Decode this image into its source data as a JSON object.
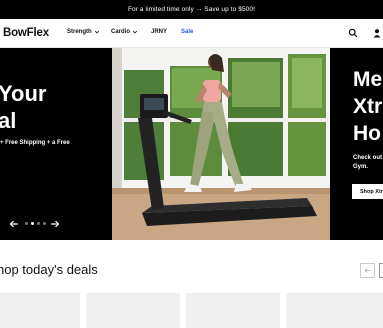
{
  "promo": {
    "text": "For a limited time only → Save up to $500!"
  },
  "nav": {
    "logo": "BowFlex",
    "items": [
      {
        "label": "Strength",
        "dropdown": true
      },
      {
        "label": "Cardio",
        "dropdown": true
      },
      {
        "label": "JRNY",
        "dropdown": false
      },
      {
        "label": "Sale",
        "dropdown": false
      }
    ],
    "icons": [
      "search-icon",
      "account-icon"
    ]
  },
  "hero": {
    "left_headline_1": "Your",
    "left_headline_2": "al",
    "left_sub": "+ Free Shipping + a Free",
    "right_headline_1": "Me",
    "right_headline_2": "Xtr",
    "right_headline_3": "Ho",
    "right_sub_1": "Check out",
    "right_sub_2": "Gym.",
    "right_button": "Shop Xtr",
    "slide_count": 4,
    "active_slide": 2
  },
  "deals": {
    "title": "hop today's deals"
  },
  "colors": {
    "sale": "#1f5fd8",
    "promo_bg": "#000000"
  }
}
